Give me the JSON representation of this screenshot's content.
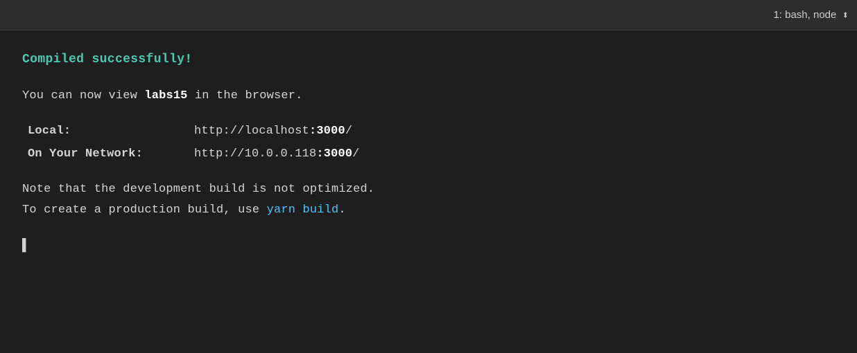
{
  "header": {
    "title": "1: bash, node",
    "selector_icon": "⬍"
  },
  "terminal": {
    "compiled_message": "Compiled successfully!",
    "view_message_prefix": "You can now view ",
    "view_message_app": "labs15",
    "view_message_suffix": " in the browser.",
    "local_label": "Local:",
    "local_url_prefix": "http://localhost",
    "local_url_port": ":3000",
    "local_url_suffix": "/",
    "network_label": "On Your Network:",
    "network_url_prefix": "http://10.0.0.118",
    "network_url_port": ":3000",
    "network_url_suffix": "/",
    "note_line1": "Note that the development build is not optimized.",
    "note_line2_prefix": "To create a production build, use ",
    "note_line2_link": "yarn build",
    "note_line2_suffix": ".",
    "cursor": "▌"
  }
}
